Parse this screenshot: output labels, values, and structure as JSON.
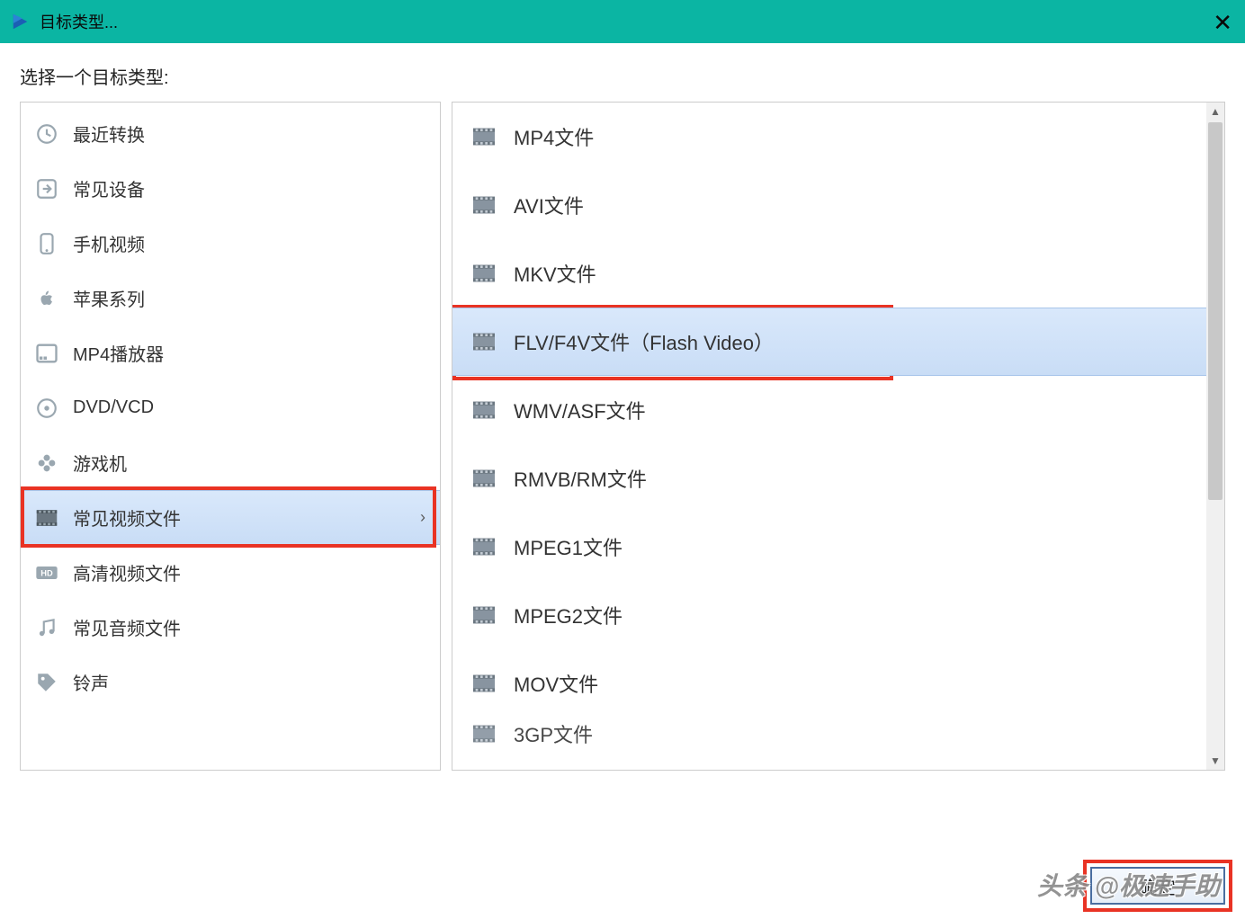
{
  "titlebar": {
    "title": "目标类型...",
    "close_label": "✕"
  },
  "prompt": "选择一个目标类型:",
  "categories": [
    {
      "label": "最近转换",
      "icon": "clock-icon"
    },
    {
      "label": "常见设备",
      "icon": "arrow-right-box-icon"
    },
    {
      "label": "手机视频",
      "icon": "phone-icon"
    },
    {
      "label": "苹果系列",
      "icon": "apple-icon"
    },
    {
      "label": "MP4播放器",
      "icon": "mp4box-icon"
    },
    {
      "label": "DVD/VCD",
      "icon": "disc-icon"
    },
    {
      "label": "游戏机",
      "icon": "gamepad-icon"
    },
    {
      "label": "常见视频文件",
      "icon": "film-icon",
      "selected": true,
      "has_children": true
    },
    {
      "label": "高清视频文件",
      "icon": "hd-icon"
    },
    {
      "label": "常见音频文件",
      "icon": "music-icon"
    },
    {
      "label": "铃声",
      "icon": "tag-icon"
    }
  ],
  "formats": [
    {
      "label": "MP4文件"
    },
    {
      "label": "AVI文件"
    },
    {
      "label": "MKV文件"
    },
    {
      "label": "FLV/F4V文件（Flash Video）",
      "selected": true
    },
    {
      "label": "WMV/ASF文件"
    },
    {
      "label": "RMVB/RM文件"
    },
    {
      "label": "MPEG1文件"
    },
    {
      "label": "MPEG2文件"
    },
    {
      "label": "MOV文件"
    },
    {
      "label": "3GP文件",
      "partial": true
    }
  ],
  "footer": {
    "ok_label": "确定"
  },
  "watermark": "头条 @极速手助"
}
